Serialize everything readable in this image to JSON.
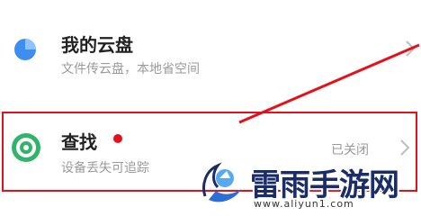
{
  "cloud": {
    "title": "我的云盘",
    "subtitle": "文件传云盘，本地省空间",
    "icon": "cloud-drive-icon"
  },
  "find": {
    "title": "查找",
    "subtitle": "设备丢失可追踪",
    "status": "已关闭",
    "icon": "find-device-icon"
  },
  "watermark": {
    "brand": "雷雨手游网",
    "url": "www.aliyun1.com"
  },
  "colors": {
    "highlight": "#e4101a",
    "cloud_blue": "#3d8ef0",
    "find_green": "#2fb46a",
    "brand_navy": "#1b2d69"
  }
}
